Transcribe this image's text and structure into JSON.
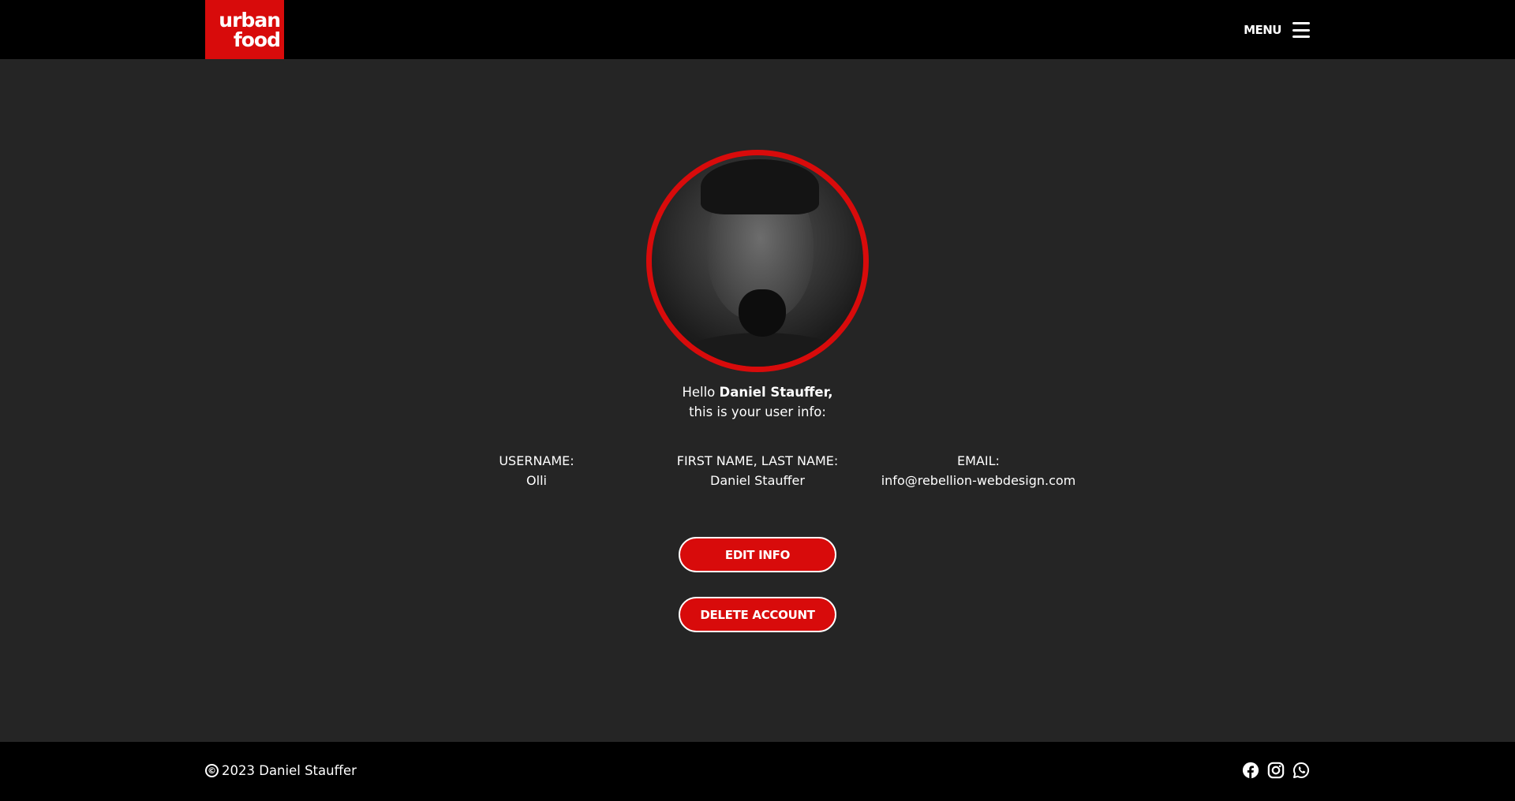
{
  "header": {
    "logo_line1": "urban",
    "logo_line2": "food",
    "menu_label": "MENU",
    "menu_icon": "hamburger-menu-icon"
  },
  "profile": {
    "greeting_prefix": "Hello",
    "name": "Daniel Stauffer,",
    "greeting_suffix": "this is your user info:",
    "fields": [
      {
        "label": "USERNAME:",
        "value": "Olli"
      },
      {
        "label": "FIRST NAME, LAST NAME:",
        "value": "Daniel Stauffer"
      },
      {
        "label": "EMAIL:",
        "value": "info@rebellion-webdesign.com"
      }
    ],
    "buttons": {
      "edit": "EDIT INFO",
      "delete": "DELETE ACCOUNT"
    }
  },
  "footer": {
    "copyright_symbol": "©",
    "copyright_text": "2023 Daniel Stauffer",
    "social_icons": [
      "facebook-icon",
      "instagram-icon",
      "whatsapp-icon"
    ]
  },
  "colors": {
    "accent": "#d80b0b",
    "background": "#252525",
    "bar": "#000000",
    "text": "#ffffff"
  }
}
